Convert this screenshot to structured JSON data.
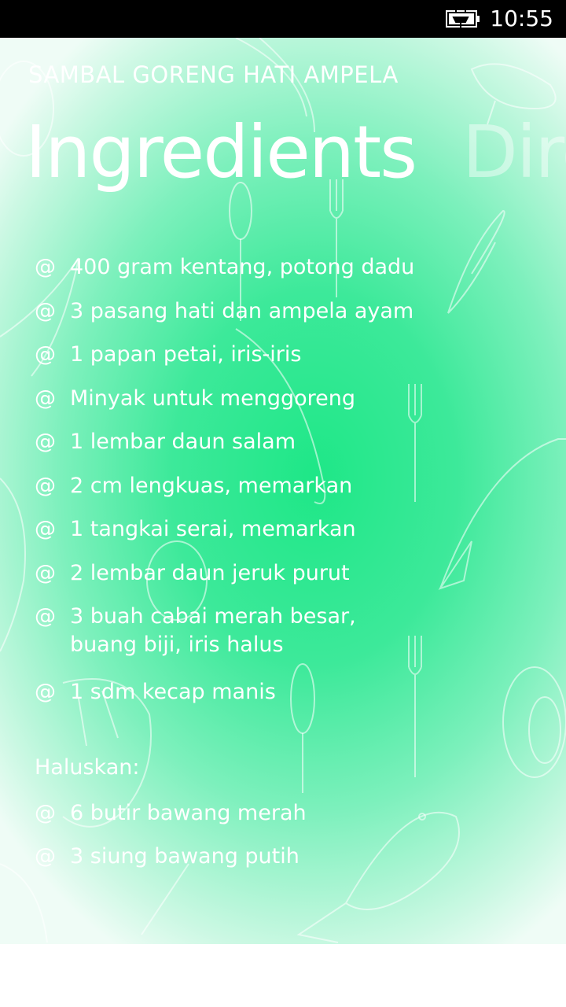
{
  "status_bar": {
    "time": "10:55",
    "battery_icon": "battery-charging-icon"
  },
  "app": {
    "title": "SAMBAL GORENG HATI AMPELA",
    "tabs": [
      {
        "label": "Ingredients",
        "active": true
      },
      {
        "label": "Directions",
        "active": false
      }
    ],
    "colors": {
      "accent": "#1EE787",
      "text": "#FFFFFF",
      "status_bar": "#000000"
    }
  },
  "ingredients": {
    "bullet": "@",
    "items": [
      "400 gram kentang, potong dadu",
      "3 pasang hati dan ampela ayam",
      "1 papan petai, iris-iris",
      "Minyak untuk menggoreng",
      "1 lembar daun salam",
      "2 cm lengkuas, memarkan",
      "1 tangkai serai, memarkan",
      "2 lembar daun jeruk purut",
      "3 buah cabai merah besar,\nbuang biji, iris halus",
      "1 sdm kecap manis"
    ],
    "section_label": "Haluskan:",
    "section_items": [
      "6 butir bawang merah",
      "3 siung bawang putih"
    ]
  }
}
